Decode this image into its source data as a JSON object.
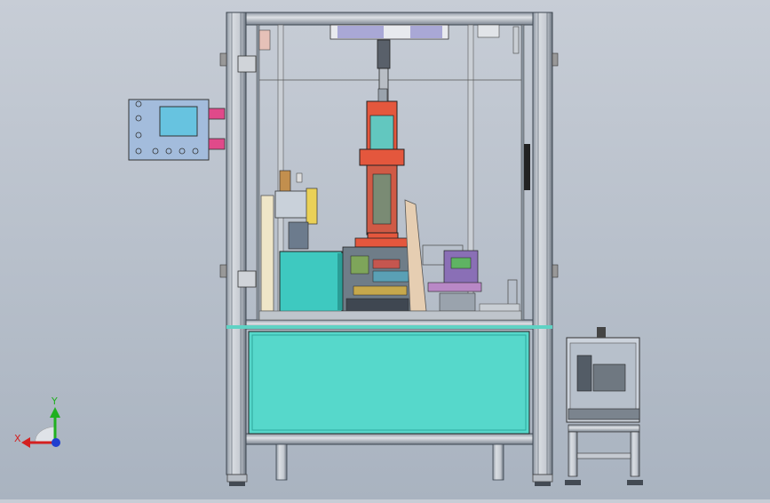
{
  "axes": {
    "x_label": "X",
    "y_label": "Y",
    "x_color": "#d42020",
    "y_color": "#20b020",
    "z_color": "#1f3fd0"
  },
  "colors": {
    "frame": "#c7ccd3",
    "frame_dark": "#56606c",
    "panel_cyan": "#4fd6c8",
    "gantry_red": "#e5553d",
    "cabinet_teal": "#3cc9c0",
    "control_box": "#9fb7d8",
    "screen": "#5fc7e4",
    "beige": "#e9d3b8"
  }
}
